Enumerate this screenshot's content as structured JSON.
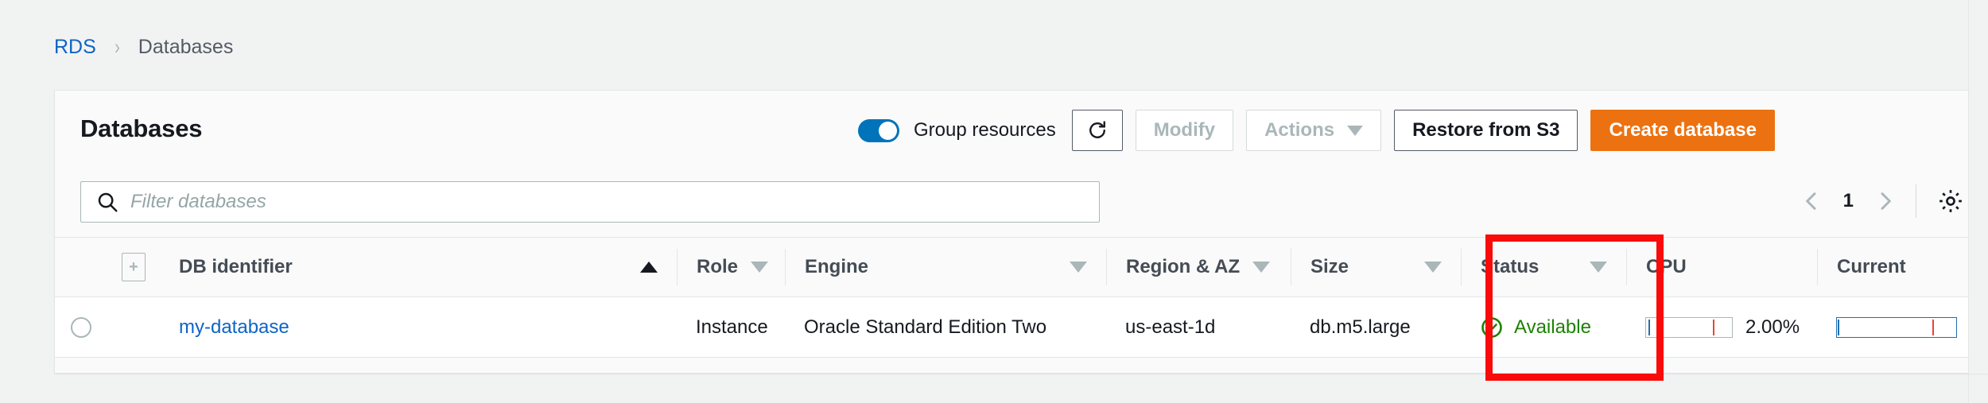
{
  "breadcrumb": {
    "root": "RDS",
    "separator": "›",
    "current": "Databases"
  },
  "panel": {
    "title": "Databases",
    "toolbar": {
      "group_resources_label": "Group resources",
      "group_resources_on": true,
      "refresh_icon": "refresh-icon",
      "modify_label": "Modify",
      "modify_disabled": true,
      "actions_label": "Actions",
      "actions_disabled": true,
      "restore_label": "Restore from S3",
      "create_label": "Create database",
      "create_color": "#ec7211"
    },
    "filter": {
      "placeholder": "Filter databases",
      "value": "",
      "search_icon": "search-icon"
    },
    "pagination": {
      "prev_icon": "chevron-left-icon",
      "page": "1",
      "next_icon": "chevron-right-icon",
      "settings_icon": "gear-icon"
    }
  },
  "table": {
    "columns": [
      {
        "key": "select",
        "label": ""
      },
      {
        "key": "expand",
        "label": ""
      },
      {
        "key": "id",
        "label": "DB identifier",
        "sort": "asc"
      },
      {
        "key": "role",
        "label": "Role",
        "sort": "none"
      },
      {
        "key": "engine",
        "label": "Engine",
        "sort": "none"
      },
      {
        "key": "region",
        "label": "Region & AZ",
        "sort": "none"
      },
      {
        "key": "size",
        "label": "Size",
        "sort": "none"
      },
      {
        "key": "status",
        "label": "Status",
        "sort": "none"
      },
      {
        "key": "cpu",
        "label": "CPU"
      },
      {
        "key": "current",
        "label": "Current"
      }
    ],
    "rows": [
      {
        "id": "my-database",
        "role": "Instance",
        "engine": "Oracle Standard Edition Two",
        "region": "us-east-1d",
        "size": "db.m5.large",
        "status": "Available",
        "status_color": "#1d8102",
        "cpu": "2.00%"
      }
    ]
  },
  "annotation": {
    "target": "status-column",
    "color": "#fb0a0a"
  }
}
